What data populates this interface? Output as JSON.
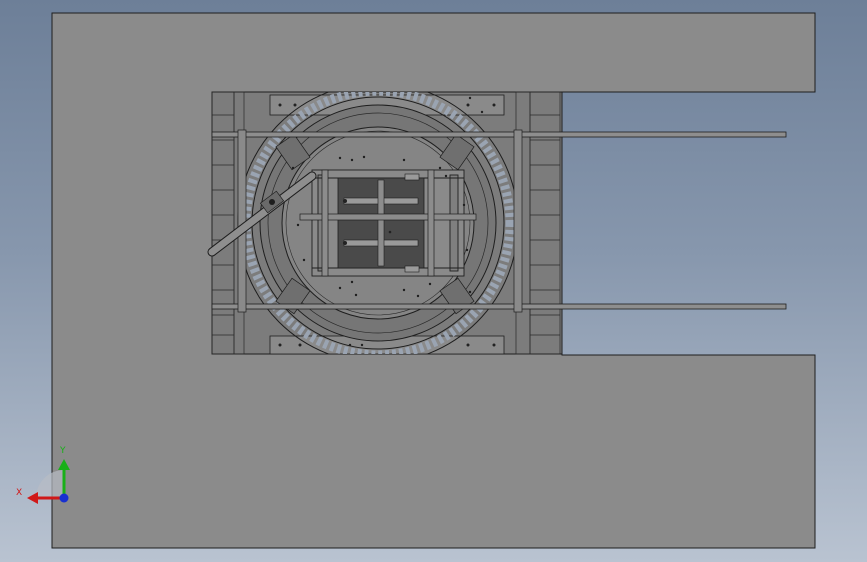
{
  "viewport": {
    "background_gradient": [
      "#6d7f98",
      "#8797ad",
      "#b9c3d1"
    ],
    "block_fill": "#8b8b8b",
    "plate_fill": "#7c7c7c",
    "edge_color": "#1e1e1e",
    "ring_color": "#9aa4b2"
  },
  "triad": {
    "x_label": "X",
    "y_label": "Y",
    "x_color": "#d01818",
    "y_color": "#18b018",
    "z_color": "#1830d0"
  }
}
